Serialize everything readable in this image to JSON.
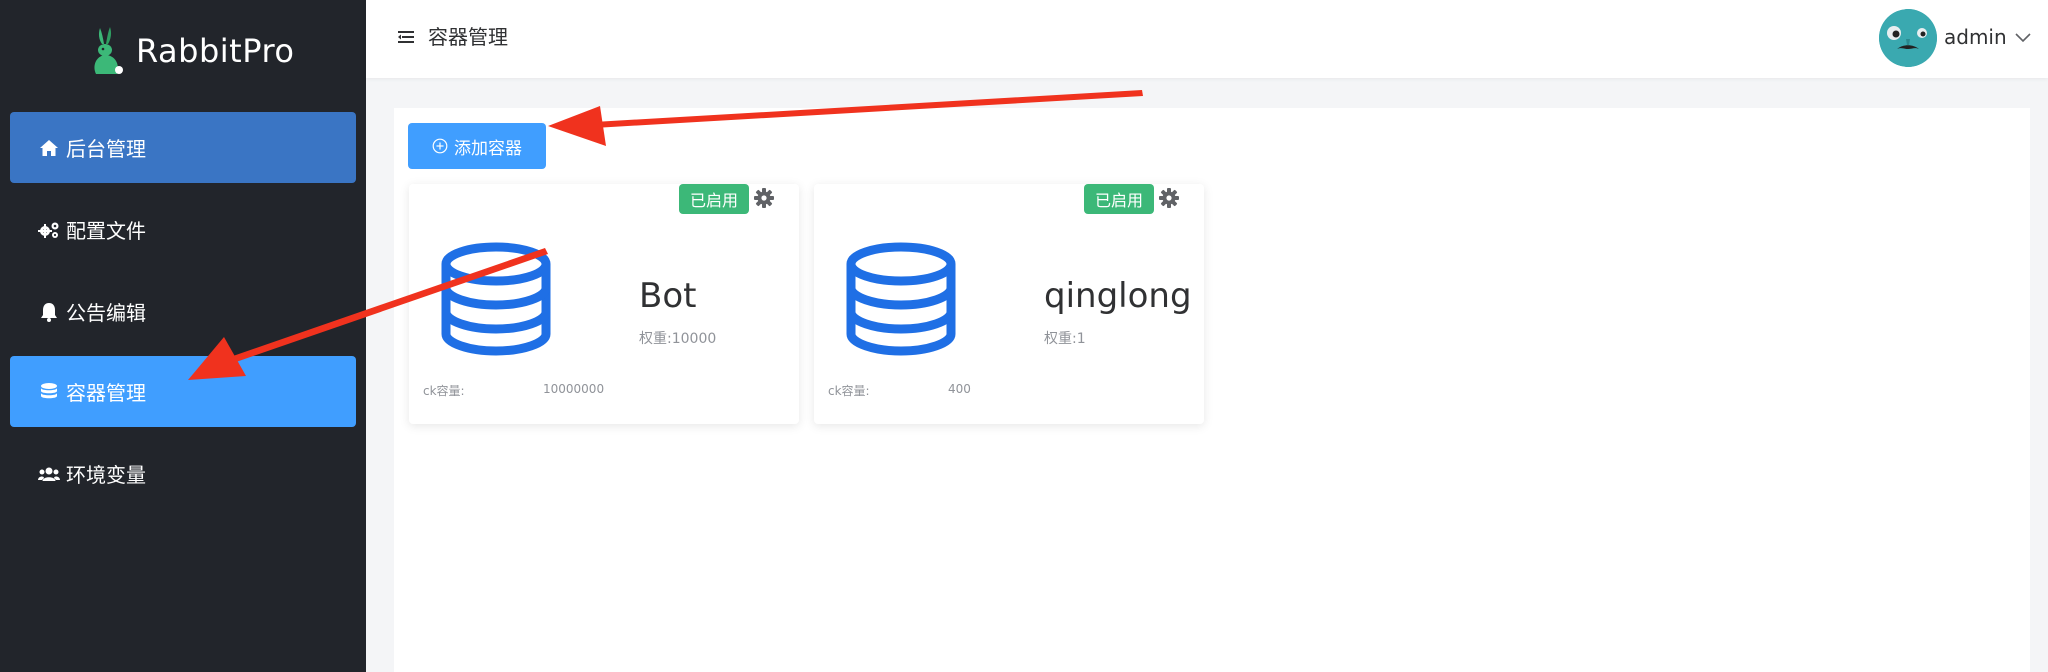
{
  "brand": {
    "name": "RabbitPro",
    "logo_icon": "rabbit-logo-icon"
  },
  "sidebar": {
    "items": [
      {
        "label": "后台管理",
        "icon": "home-icon"
      },
      {
        "label": "配置文件",
        "icon": "gears-icon"
      },
      {
        "label": "公告编辑",
        "icon": "bell-icon"
      },
      {
        "label": "容器管理",
        "icon": "database-icon"
      },
      {
        "label": "环境变量",
        "icon": "users-icon"
      }
    ],
    "active_index": 3
  },
  "header": {
    "title": "容器管理",
    "username": "admin"
  },
  "toolbar": {
    "add_label": "添加容器"
  },
  "containers": [
    {
      "name": "Bot",
      "weight": "权重:10000",
      "ck_label": "ck容量:",
      "ck_value": "10000000",
      "status": "已启用"
    },
    {
      "name": "qinglong",
      "weight": "权重:1",
      "ck_label": "ck容量:",
      "ck_value": "400",
      "status": "已启用"
    }
  ],
  "colors": {
    "sidebar_bg": "#22252b",
    "primary": "#409eff",
    "success": "#3cb878",
    "db_icon": "#1f6fe5",
    "annotation_arrow": "#f0321e"
  }
}
